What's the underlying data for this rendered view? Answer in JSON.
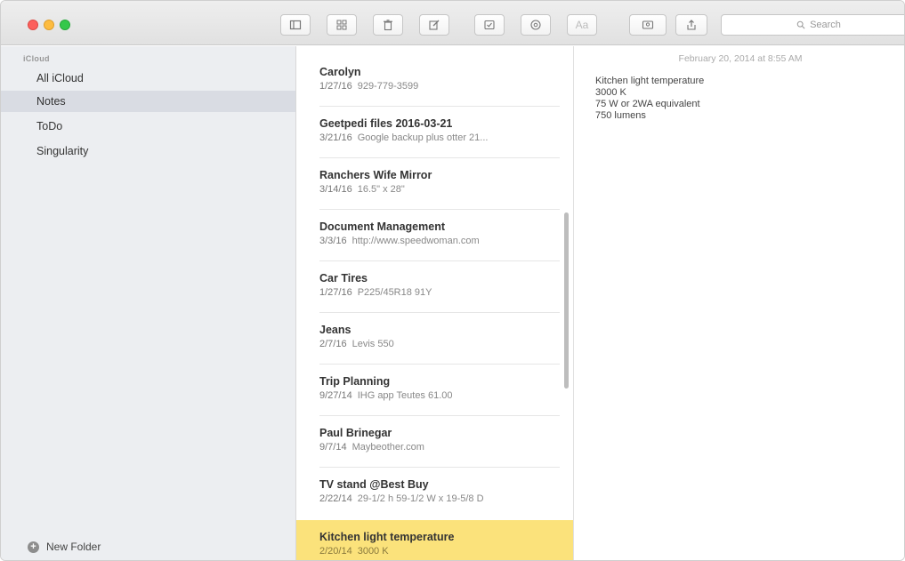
{
  "toolbar": {
    "search_placeholder": "Search",
    "font_label": "Aa"
  },
  "sidebar": {
    "group": "iCloud",
    "items": [
      {
        "label": "All iCloud"
      },
      {
        "label": "Notes"
      },
      {
        "label": "ToDo"
      },
      {
        "label": "Singularity"
      }
    ],
    "new_folder": "New Folder"
  },
  "notes": [
    {
      "title": "Carolyn",
      "date": "1/27/16",
      "preview": "929-779-3599"
    },
    {
      "title": "Geetpedi files 2016-03-21",
      "date": "3/21/16",
      "preview": "Google backup plus otter 21..."
    },
    {
      "title": "Ranchers Wife Mirror",
      "date": "3/14/16",
      "preview": "16.5\" x 28\""
    },
    {
      "title": "Document Management",
      "date": "3/3/16",
      "preview": "http://www.speedwoman.com"
    },
    {
      "title": "Car Tires",
      "date": "1/27/16",
      "preview": "P225/45R18 91Y"
    },
    {
      "title": "Jeans",
      "date": "2/7/16",
      "preview": "Levis 550"
    },
    {
      "title": "Trip Planning",
      "date": "9/27/14",
      "preview": "IHG app  Teutes 61.00"
    },
    {
      "title": "Paul Brinegar",
      "date": "9/7/14",
      "preview": "Maybeother.com"
    },
    {
      "title": "TV stand @Best Buy",
      "date": "2/22/14",
      "preview": "29-1/2 h 59-1/2 W x 19-5/8 D"
    },
    {
      "title": "Kitchen light temperature",
      "date": "2/20/14",
      "preview": "3000 K"
    }
  ],
  "editor": {
    "date": "February 20, 2014 at 8:55 AM",
    "lines": [
      "Kitchen light temperature",
      "3000 K",
      "75 W or 2WA equivalent",
      "750 lumens"
    ]
  },
  "colors": {
    "selected_note": "#fbe27b",
    "sidebar_bg": "#eceef1",
    "sidebar_selected": "#d9dce3"
  }
}
